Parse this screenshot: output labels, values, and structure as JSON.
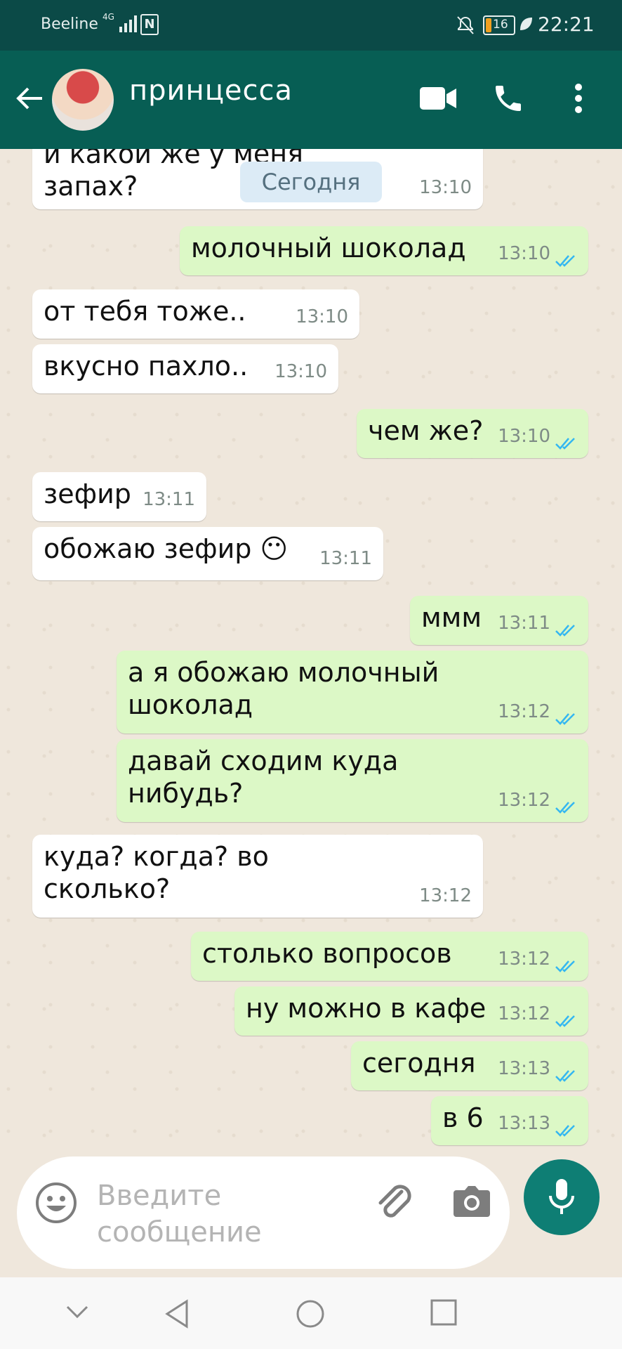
{
  "status_bar": {
    "carrier": "Beeline",
    "network": "4G",
    "battery_level": "16",
    "time": "22:21"
  },
  "header": {
    "contact_name": "принцесса"
  },
  "chat": {
    "date_label": "Сегодня",
    "messages": [
      {
        "dir": "in",
        "text": "и какой же у меня\nзапах?",
        "time": "13:10"
      },
      {
        "dir": "out",
        "text": "молочный шоколад",
        "time": "13:10"
      },
      {
        "dir": "in",
        "text": "от тебя тоже..",
        "time": "13:10"
      },
      {
        "dir": "in",
        "text": "вкусно пахло..",
        "time": "13:10"
      },
      {
        "dir": "out",
        "text": "чем же?",
        "time": "13:10"
      },
      {
        "dir": "in",
        "text": "зефир",
        "time": "13:11"
      },
      {
        "dir": "in",
        "text": "обожаю зефир 😶",
        "time": "13:11"
      },
      {
        "dir": "out",
        "text": "ммм",
        "time": "13:11"
      },
      {
        "dir": "out",
        "text": "а я обожаю молочный\nшоколад",
        "time": "13:12"
      },
      {
        "dir": "out",
        "text": "давай сходим куда\nнибудь?",
        "time": "13:12"
      },
      {
        "dir": "in",
        "text": "куда? когда? во\nсколько?",
        "time": "13:12"
      },
      {
        "dir": "out",
        "text": "столько вопросов",
        "time": "13:12"
      },
      {
        "dir": "out",
        "text": "ну можно в кафе",
        "time": "13:12"
      },
      {
        "dir": "out",
        "text": "сегодня",
        "time": "13:13"
      },
      {
        "dir": "out",
        "text": "в 6",
        "time": "13:13"
      }
    ]
  },
  "composer": {
    "placeholder": "Введите\nсообщение"
  },
  "colors": {
    "header": "#075e54",
    "status_bar": "#0b4a47",
    "outgoing_bubble": "#dcf8c6",
    "incoming_bubble": "#ffffff",
    "read_ticks": "#34b7f1",
    "mic_button": "#0e7e74"
  },
  "icons": [
    "back-arrow-icon",
    "video-call-icon",
    "phone-icon",
    "more-vert-icon",
    "emoji-icon",
    "attach-icon",
    "camera-icon",
    "mic-icon"
  ]
}
